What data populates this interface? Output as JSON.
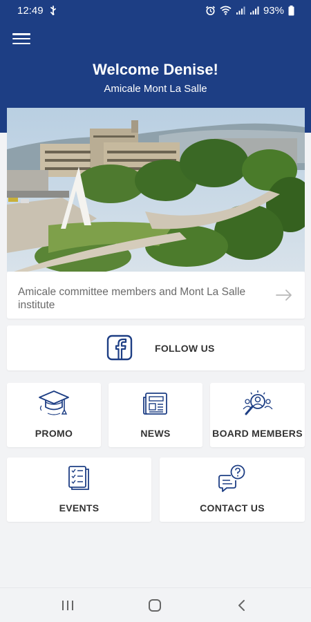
{
  "status_bar": {
    "time": "12:49",
    "battery_percent": "93%",
    "icons": [
      "usb-icon",
      "alarm-icon",
      "wifi-icon",
      "signal-icon",
      "signal-icon",
      "battery-icon"
    ]
  },
  "header": {
    "menu_icon": "hamburger-menu-icon",
    "welcome": "Welcome Denise!",
    "subtitle": "Amicale Mont La Salle"
  },
  "hero": {
    "caption": "Amicale committee members and Mont La Salle institute",
    "arrow_icon": "arrow-right-icon"
  },
  "follow": {
    "label": "FOLLOW US",
    "icon": "facebook-icon"
  },
  "tiles": [
    {
      "label": "PROMO",
      "icon": "graduation-cap-icon"
    },
    {
      "label": "NEWS",
      "icon": "newspaper-icon"
    },
    {
      "label": "BOARD MEMBERS",
      "icon": "board-members-icon"
    },
    {
      "label": "EVENTS",
      "icon": "checklist-icon"
    },
    {
      "label": "CONTACT US",
      "icon": "chat-question-icon"
    }
  ],
  "nav_bar": {
    "icons": [
      "recents-icon",
      "home-icon",
      "back-icon"
    ]
  },
  "colors": {
    "brand_blue": "#1d3e84",
    "icon_blue": "#1d3e84",
    "background": "#f2f3f5",
    "card": "#ffffff"
  }
}
